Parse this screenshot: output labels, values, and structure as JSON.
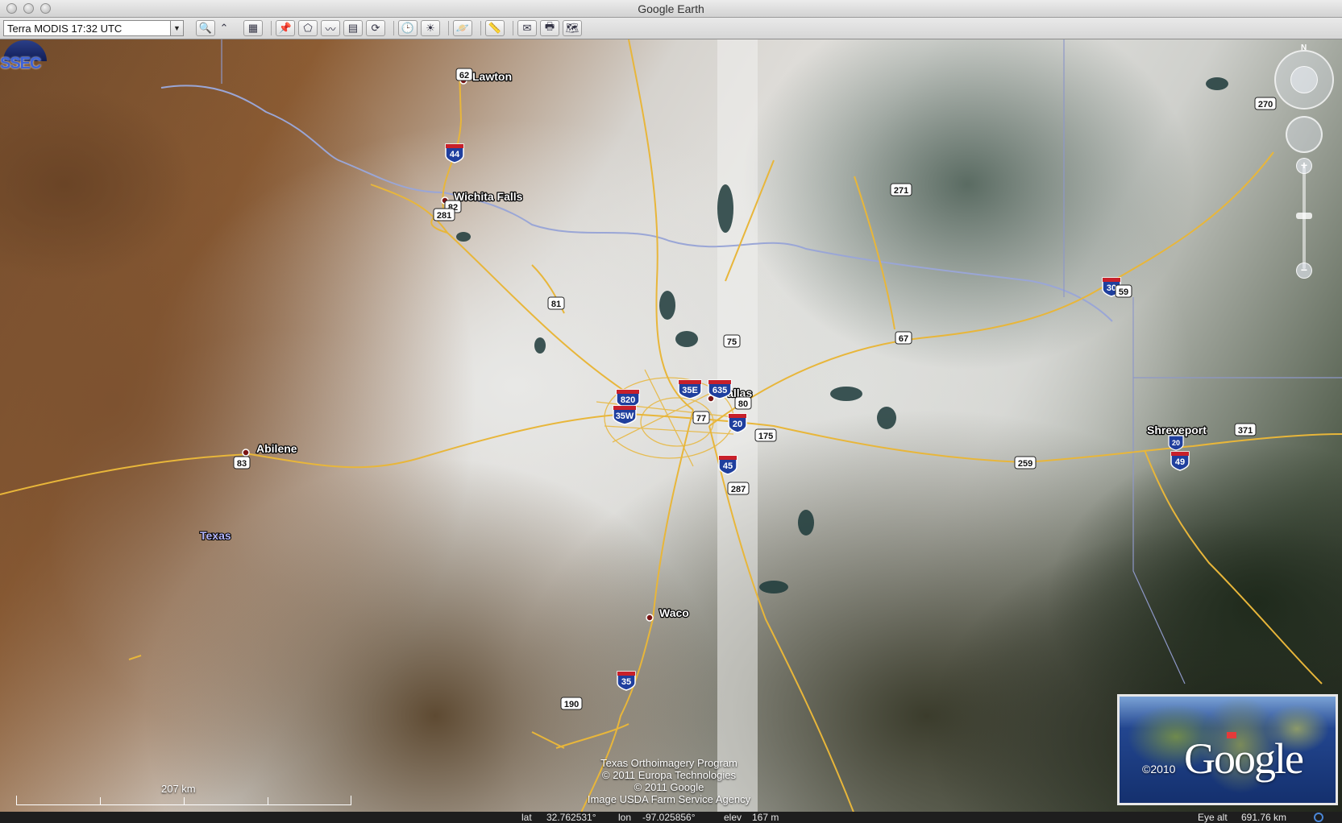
{
  "window": {
    "title": "Google Earth"
  },
  "toolbar": {
    "layer_select": "Terra MODIS 17:32 UTC",
    "buttons": [
      {
        "name": "search-icon",
        "glyph": "🔍"
      },
      {
        "name": "collapse-arrow-icon",
        "glyph": "⌃"
      },
      {
        "name": "sidebar-toggle-icon",
        "glyph": "▦"
      },
      {
        "name": "placemark-icon",
        "glyph": "📌"
      },
      {
        "name": "polygon-icon",
        "glyph": "⬠"
      },
      {
        "name": "path-icon",
        "glyph": "〰"
      },
      {
        "name": "image-overlay-icon",
        "glyph": "▤"
      },
      {
        "name": "record-tour-icon",
        "glyph": "⟳"
      },
      {
        "name": "historical-imagery-icon",
        "glyph": "🕒"
      },
      {
        "name": "sunlight-icon",
        "glyph": "☀"
      },
      {
        "name": "planets-icon",
        "glyph": "🪐"
      },
      {
        "name": "ruler-icon",
        "glyph": "📏"
      },
      {
        "name": "email-icon",
        "glyph": "✉"
      },
      {
        "name": "print-icon",
        "glyph": "🖶"
      },
      {
        "name": "view-in-maps-icon",
        "glyph": "🗺"
      }
    ]
  },
  "map": {
    "logo_text": "SSEC",
    "north_label": "N",
    "state_label": "Texas",
    "cities": [
      {
        "name": "Lawton"
      },
      {
        "name": "Wichita Falls"
      },
      {
        "name": "Abilene"
      },
      {
        "name": "Dallas"
      },
      {
        "name": "Waco"
      },
      {
        "name": "Shreveport"
      }
    ],
    "interstate_shields": [
      "44",
      "820",
      "35W",
      "35E",
      "635",
      "20",
      "45",
      "35",
      "30",
      "49",
      "20"
    ],
    "us_shields": [
      "62",
      "82",
      "281",
      "81",
      "75",
      "80",
      "77",
      "175",
      "287",
      "83",
      "190",
      "271",
      "67",
      "59",
      "259",
      "371",
      "270"
    ],
    "attribution": [
      "Texas Orthoimagery Program",
      "© 2011 Europa Technologies",
      "© 2011 Google",
      "Image USDA Farm Service Agency"
    ],
    "scale_label": "207 km",
    "inset": {
      "copyright": "©2010",
      "logo": "Google"
    },
    "zoom_in": "+",
    "zoom_out": "−"
  },
  "status": {
    "lat_label": "lat",
    "lat_value": "32.762531°",
    "lon_label": "lon",
    "lon_value": "-97.025856°",
    "elev_label": "elev",
    "elev_value": "167 m",
    "eye_alt_label": "Eye alt",
    "eye_alt_value": "691.76 km"
  },
  "colors": {
    "road": "#e8b63a",
    "river": "#9aa6d6",
    "border": "#8e98c8",
    "interstate_blue": "#1f3f9e",
    "interstate_red": "#c8202a"
  }
}
